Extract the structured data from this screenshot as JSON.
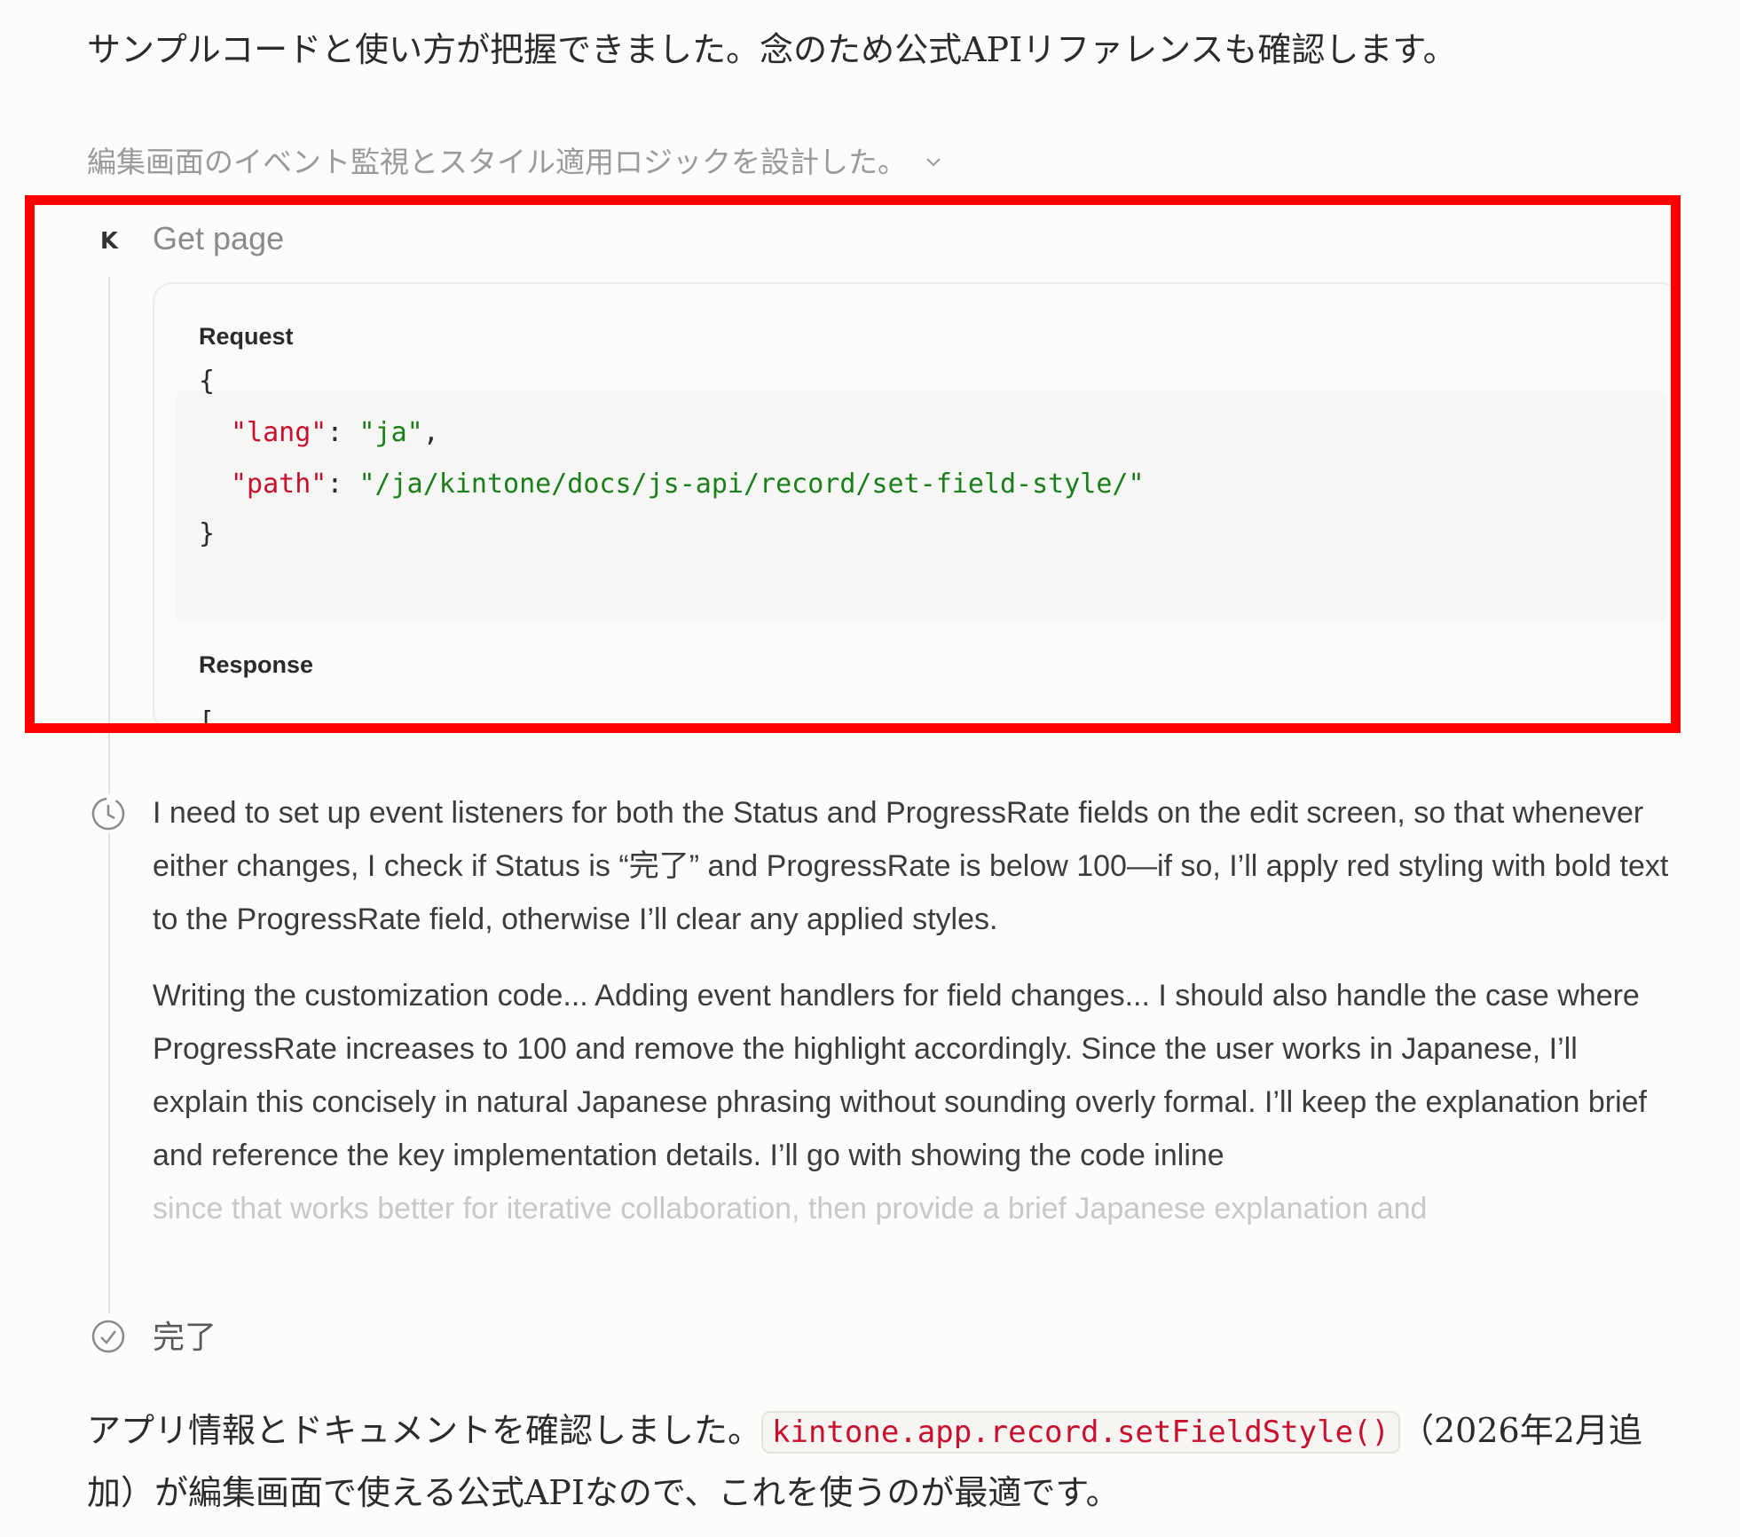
{
  "intro_text": "サンプルコードと使い方が把握できました。念のため公式APIリファレンスも確認します。",
  "thinking_summary": {
    "label": "編集画面のイベント監視とスタイル適用ロジックを設計した。",
    "icon": "chevron-down-icon"
  },
  "tool_call": {
    "icon_glyph": "K",
    "title": "Get page",
    "request_label": "Request",
    "request": {
      "open": "{",
      "close": "}",
      "lang_key": "\"lang\"",
      "lang_value": "\"ja\"",
      "path_key": "\"path\"",
      "path_value": "\"/ja/kintone/docs/js-api/record/set-field-style/\""
    },
    "response_label": "Response",
    "response_peek": "["
  },
  "thinking": {
    "icon": "clock-icon",
    "paragraphs": [
      "I need to set up event listeners for both the Status and ProgressRate fields on the edit screen, so that whenever either changes, I check if Status is “完了” and ProgressRate is below 100—if so, I’ll apply red styling with bold text to the ProgressRate field, otherwise I’ll clear any applied styles.",
      "Writing the customization code... Adding event handlers for field changes... I should also handle the case where ProgressRate increases to 100 and remove the highlight accordingly. Since the user works in Japanese, I’ll explain this concisely in natural Japanese phrasing without sounding overly formal. I’ll keep the explanation brief and reference the key implementation details. I’ll go with showing the code inline"
    ],
    "faded_line": "since that works better for iterative collaboration, then provide a brief Japanese explanation and"
  },
  "done": {
    "icon": "check-circle-icon",
    "label": "完了"
  },
  "final_text": {
    "before": "アプリ情報とドキュメントを確認しました。",
    "code": "kintone.app.record.setFieldStyle()",
    "after": "（2026年2月追加）が編集画面で使える公式APIなので、これを使うのが最適です。"
  },
  "colors": {
    "highlight": "#ff0000",
    "code_key": "#c8102e",
    "code_string": "#1a7f1a"
  }
}
